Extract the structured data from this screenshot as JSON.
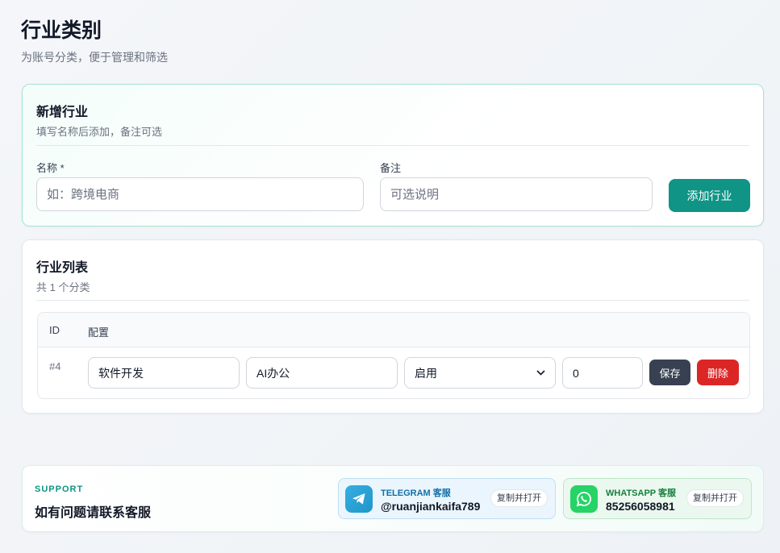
{
  "header": {
    "title": "行业类别",
    "subtitle": "为账号分类，便于管理和筛选"
  },
  "add_form": {
    "title": "新增行业",
    "subtitle": "填写名称后添加，备注可选",
    "name_label": "名称 *",
    "name_placeholder": "如：跨境电商",
    "note_label": "备注",
    "note_placeholder": "可选说明",
    "submit_label": "添加行业"
  },
  "list": {
    "title": "行业列表",
    "count_text": "共 1 个分类",
    "columns": [
      "ID",
      "配置"
    ],
    "rows": [
      {
        "id": "#4",
        "name": "软件开发",
        "note": "AI办公",
        "status": "启用",
        "sort": "0",
        "save_label": "保存",
        "delete_label": "删除"
      }
    ]
  },
  "support": {
    "eyebrow": "SUPPORT",
    "title": "如有问题请联系客服",
    "contacts": [
      {
        "label": "TELEGRAM 客服",
        "value": "@ruanjiankaifa789",
        "action": "复制并打开",
        "icon": "telegram-icon"
      },
      {
        "label": "WHATSAPP 客服",
        "value": "85256058981",
        "action": "复制并打开",
        "icon": "whatsapp-icon"
      }
    ]
  },
  "colors": {
    "primary": "#0f9486",
    "danger": "#dc2626",
    "dark_button": "#374151",
    "telegram": "#2aa3d8",
    "whatsapp": "#25d366"
  }
}
